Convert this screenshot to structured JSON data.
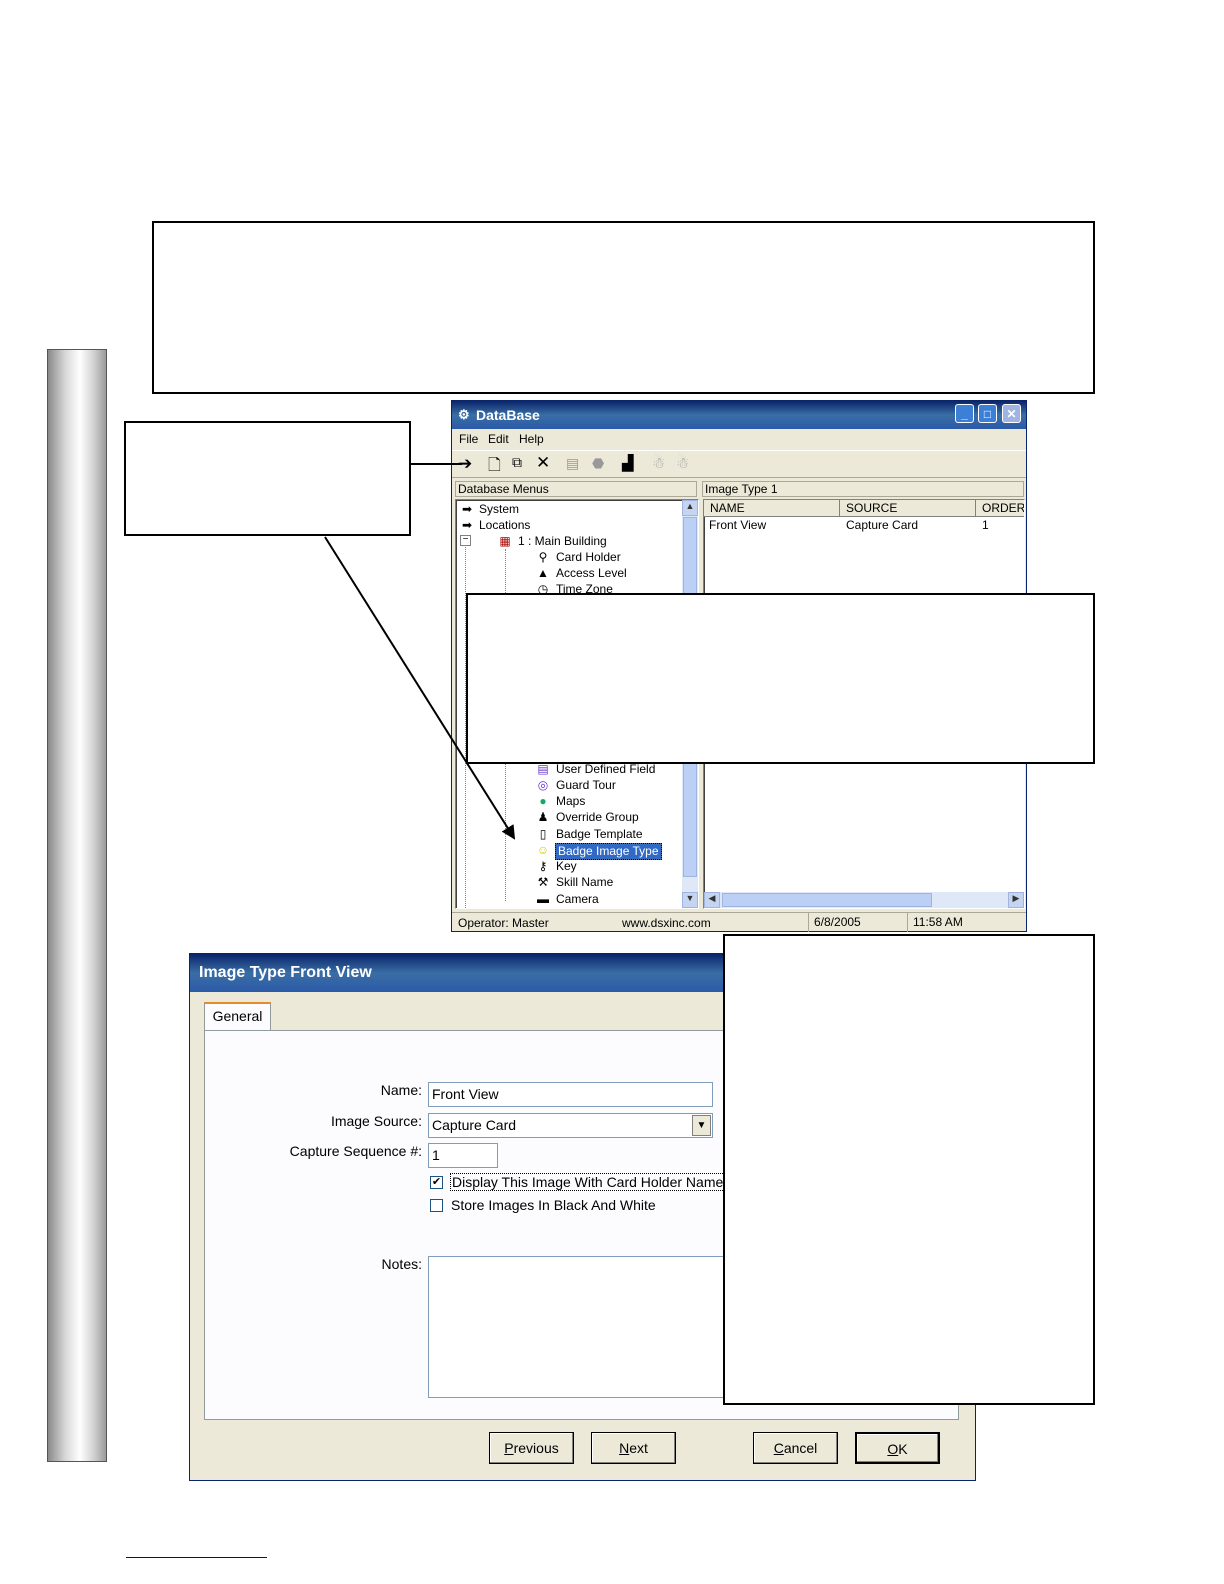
{
  "database_window": {
    "title": "DataBase",
    "menu": [
      "File",
      "Edit",
      "Help"
    ],
    "left_panel_label": "Database Menus",
    "right_panel_label": "Image Type   1",
    "tree_items": [
      {
        "label": "System",
        "icon": "arrow-right-icon"
      },
      {
        "label": "Locations",
        "icon": "arrow-right-icon"
      },
      {
        "label": "1 : Main Building",
        "icon": "building-icon"
      },
      {
        "label": "Card Holder",
        "icon": "person-icon"
      },
      {
        "label": "Access Level",
        "icon": "pyramid-icon"
      },
      {
        "label": "Time Zone",
        "icon": "clock-icon"
      },
      {
        "label": "User Defined Field",
        "icon": "form-icon"
      },
      {
        "label": "Guard Tour",
        "icon": "tour-icon"
      },
      {
        "label": "Maps",
        "icon": "globe-icon"
      },
      {
        "label": "Override Group",
        "icon": "group-icon"
      },
      {
        "label": "Badge Template",
        "icon": "badge-icon"
      },
      {
        "label": "Badge Image Type",
        "icon": "smiley-icon"
      },
      {
        "label": "Key",
        "icon": "key-icon"
      },
      {
        "label": "Skill Name",
        "icon": "tool-icon"
      },
      {
        "label": "Camera",
        "icon": "camera-icon"
      }
    ],
    "selected_item": "Badge Image Type",
    "list_columns": [
      "NAME",
      "SOURCE",
      "ORDER"
    ],
    "list_rows": [
      [
        "Front View",
        "Capture Card",
        "1"
      ]
    ],
    "status": {
      "operator": "Operator:  Master",
      "website": "www.dsxinc.com",
      "date": "6/8/2005",
      "time": "11:58 AM"
    }
  },
  "dialog": {
    "title": "Image Type Front View",
    "tab": "General",
    "labels": {
      "name": "Name:",
      "image_source": "Image Source:",
      "capture_sequence": "Capture Sequence #:",
      "notes": "Notes:"
    },
    "values": {
      "name": "Front View",
      "image_source": "Capture Card",
      "capture_sequence": "1",
      "notes": ""
    },
    "checkboxes": [
      {
        "label": "Display This Image With Card Holder Name",
        "checked": true
      },
      {
        "label": "Store Images In Black And White",
        "checked": false
      }
    ],
    "buttons": {
      "previous": "Previous",
      "next": "Next",
      "cancel": "Cancel",
      "ok": "OK"
    }
  },
  "colors": {
    "titlebar": "#0a246a",
    "selection": "#316ac5",
    "window_bg": "#ece9d8"
  }
}
